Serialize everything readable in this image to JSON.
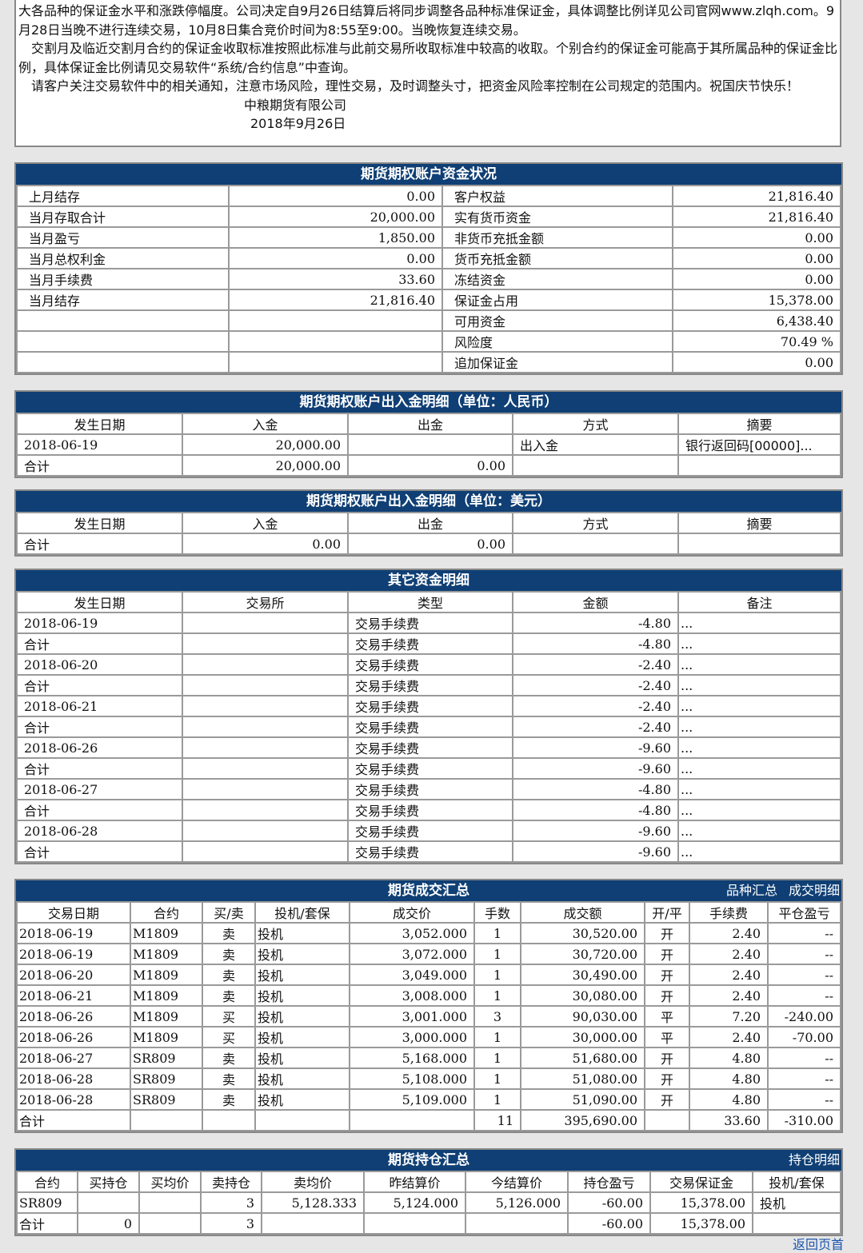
{
  "notice": {
    "lines": [
      "大各品种的保证金水平和涨跌停幅度。公司决定自9月26日结算后将同步调整各品种标准保证金，具体调整比例详见公司官网www.zlqh.com。9月28日当晚不进行连续交易，10月8日集合竞价时间为8:55至9:00。当晚恢复连续交易。",
      "　交割月及临近交割月合约的保证金收取标准按照此标准与此前交易所收取标准中较高的收取。个别合约的保证金可能高于其所属品种的保证金比例，具体保证金比例请见交易软件“系统/合约信息”中查询。",
      "　请客户关注交易软件中的相关通知，注意市场风险，理性交易，及时调整头寸，把资金风险率控制在公司规定的范围内。祝国庆节快乐！"
    ],
    "company": "中粮期货有限公司",
    "date": "2018年9月26日"
  },
  "funds": {
    "title": "期货期权账户资金状况",
    "rows": [
      [
        "上月结存",
        "0.00",
        "客户权益",
        "21,816.40"
      ],
      [
        "当月存取合计",
        "20,000.00",
        "实有货币资金",
        "21,816.40"
      ],
      [
        "当月盈亏",
        "1,850.00",
        "非货币充抵金额",
        "0.00"
      ],
      [
        "当月总权利金",
        "0.00",
        "货币充抵金额",
        "0.00"
      ],
      [
        "当月手续费",
        "33.60",
        "冻结资金",
        "0.00"
      ],
      [
        "当月结存",
        "21,816.40",
        "保证金占用",
        "15,378.00"
      ],
      [
        "",
        "",
        "可用资金",
        "6,438.40"
      ],
      [
        "",
        "",
        "风险度",
        "70.49 %"
      ],
      [
        "",
        "",
        "追加保证金",
        "0.00"
      ]
    ]
  },
  "rmb": {
    "title": "期货期权账户出入金明细（单位：人民币）",
    "headers": [
      "发生日期",
      "入金",
      "出金",
      "方式",
      "摘要"
    ],
    "rows": [
      [
        "2018-06-19",
        "20,000.00",
        "",
        "出入金",
        "银行返回码[00000]..."
      ],
      [
        "合计",
        "20,000.00",
        "0.00",
        "",
        ""
      ]
    ]
  },
  "usd": {
    "title": "期货期权账户出入金明细（单位：美元）",
    "headers": [
      "发生日期",
      "入金",
      "出金",
      "方式",
      "摘要"
    ],
    "rows": [
      [
        "合计",
        "0.00",
        "0.00",
        "",
        ""
      ]
    ]
  },
  "other": {
    "title": "其它资金明细",
    "headers": [
      "发生日期",
      "交易所",
      "类型",
      "金额",
      "备注"
    ],
    "rows": [
      [
        "2018-06-19",
        "",
        "交易手续费",
        "-4.80",
        "..."
      ],
      [
        "合计",
        "",
        "交易手续费",
        "-4.80",
        "..."
      ],
      [
        "2018-06-20",
        "",
        "交易手续费",
        "-2.40",
        "..."
      ],
      [
        "合计",
        "",
        "交易手续费",
        "-2.40",
        "..."
      ],
      [
        "2018-06-21",
        "",
        "交易手续费",
        "-2.40",
        "..."
      ],
      [
        "合计",
        "",
        "交易手续费",
        "-2.40",
        "..."
      ],
      [
        "2018-06-26",
        "",
        "交易手续费",
        "-9.60",
        "..."
      ],
      [
        "合计",
        "",
        "交易手续费",
        "-9.60",
        "..."
      ],
      [
        "2018-06-27",
        "",
        "交易手续费",
        "-4.80",
        "..."
      ],
      [
        "合计",
        "",
        "交易手续费",
        "-4.80",
        "..."
      ],
      [
        "2018-06-28",
        "",
        "交易手续费",
        "-9.60",
        "..."
      ],
      [
        "合计",
        "",
        "交易手续费",
        "-9.60",
        "..."
      ]
    ]
  },
  "trades": {
    "title": "期货成交汇总",
    "links": [
      "品种汇总",
      "成交明细"
    ],
    "headers": [
      "交易日期",
      "合约",
      "买/卖",
      "投机/套保",
      "成交价",
      "手数",
      "成交额",
      "开/平",
      "手续费",
      "平仓盈亏"
    ],
    "rows": [
      [
        "2018-06-19",
        "M1809",
        "卖",
        "投机",
        "3,052.000",
        "1",
        "30,520.00",
        "开",
        "2.40",
        "--"
      ],
      [
        "2018-06-19",
        "M1809",
        "卖",
        "投机",
        "3,072.000",
        "1",
        "30,720.00",
        "开",
        "2.40",
        "--"
      ],
      [
        "2018-06-20",
        "M1809",
        "卖",
        "投机",
        "3,049.000",
        "1",
        "30,490.00",
        "开",
        "2.40",
        "--"
      ],
      [
        "2018-06-21",
        "M1809",
        "卖",
        "投机",
        "3,008.000",
        "1",
        "30,080.00",
        "开",
        "2.40",
        "--"
      ],
      [
        "2018-06-26",
        "M1809",
        "买",
        "投机",
        "3,001.000",
        "3",
        "90,030.00",
        "平",
        "7.20",
        "-240.00"
      ],
      [
        "2018-06-26",
        "M1809",
        "买",
        "投机",
        "3,000.000",
        "1",
        "30,000.00",
        "平",
        "2.40",
        "-70.00"
      ],
      [
        "2018-06-27",
        "SR809",
        "卖",
        "投机",
        "5,168.000",
        "1",
        "51,680.00",
        "开",
        "4.80",
        "--"
      ],
      [
        "2018-06-28",
        "SR809",
        "卖",
        "投机",
        "5,108.000",
        "1",
        "51,080.00",
        "开",
        "4.80",
        "--"
      ],
      [
        "2018-06-28",
        "SR809",
        "卖",
        "投机",
        "5,109.000",
        "1",
        "51,090.00",
        "开",
        "4.80",
        "--"
      ]
    ],
    "total": [
      "合计",
      "",
      "",
      "",
      "",
      "11",
      "395,690.00",
      "",
      "33.60",
      "-310.00"
    ]
  },
  "positions": {
    "title": "期货持仓汇总",
    "link": "持仓明细",
    "headers": [
      "合约",
      "买持仓",
      "买均价",
      "卖持仓",
      "卖均价",
      "昨结算价",
      "今结算价",
      "持仓盈亏",
      "交易保证金",
      "投机/套保"
    ],
    "rows": [
      [
        "SR809",
        "",
        "",
        "3",
        "5,128.333",
        "5,124.000",
        "5,126.000",
        "-60.00",
        "15,378.00",
        "投机"
      ]
    ],
    "total": [
      "合计",
      "0",
      "",
      "3",
      "",
      "",
      "",
      "-60.00",
      "15,378.00",
      ""
    ]
  },
  "back_link": "返回页首"
}
